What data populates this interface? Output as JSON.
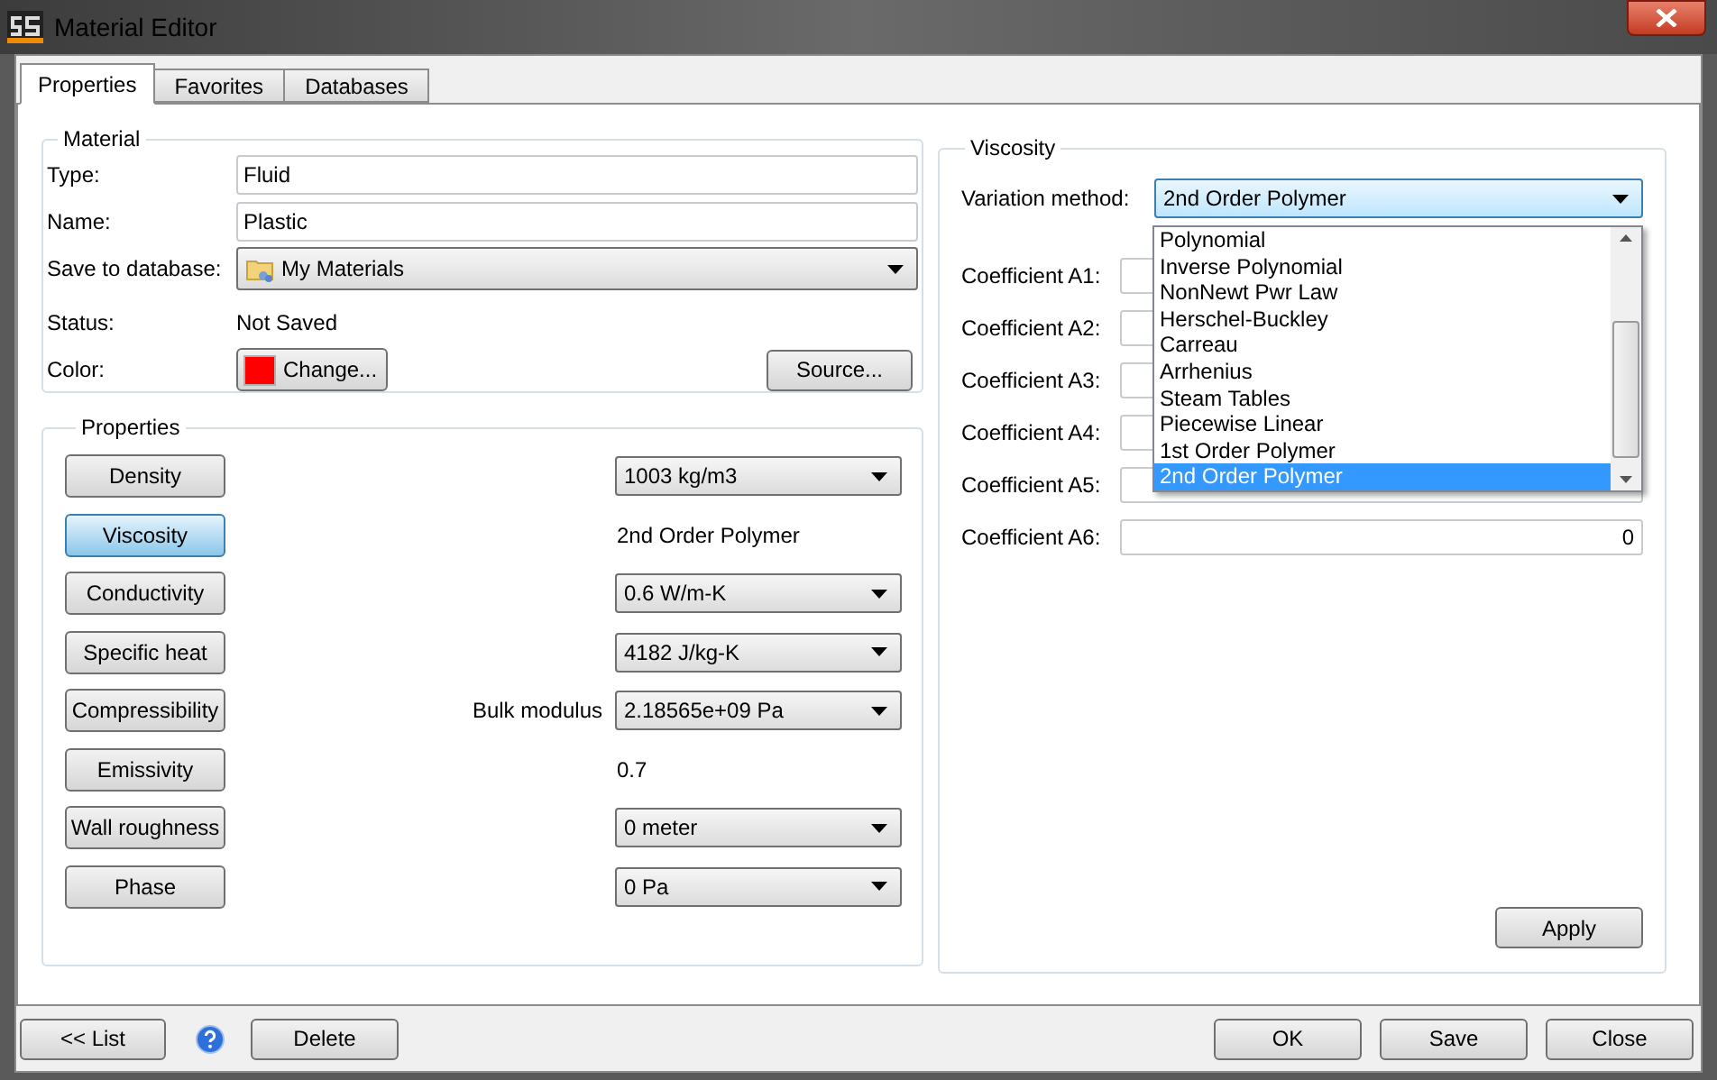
{
  "window": {
    "title": "Material Editor"
  },
  "tabs": [
    {
      "label": "Properties",
      "selected": true
    },
    {
      "label": "Favorites",
      "selected": false
    },
    {
      "label": "Databases",
      "selected": false
    }
  ],
  "material": {
    "title": "Material",
    "fields": [
      {
        "label": "Type:",
        "value": "Fluid",
        "kind": "input"
      },
      {
        "label": "Name:",
        "value": "Plastic",
        "kind": "input"
      },
      {
        "label": "Save to database:",
        "value": "My Materials",
        "kind": "dropdown"
      },
      {
        "label": "Status:",
        "value": "Not Saved",
        "kind": "text"
      }
    ],
    "color": {
      "label": "Color:",
      "color": "#ff0000",
      "button": "Change..."
    },
    "source_button": "Source..."
  },
  "properties": {
    "title": "Properties",
    "rows": [
      {
        "button": "Density",
        "selected": false,
        "kind": "dropdown",
        "value": "1003 kg/m3"
      },
      {
        "button": "Viscosity",
        "selected": true,
        "kind": "text",
        "value": "2nd Order Polymer"
      },
      {
        "button": "Conductivity",
        "selected": false,
        "kind": "dropdown",
        "value": "0.6 W/m-K"
      },
      {
        "button": "Specific heat",
        "selected": false,
        "kind": "dropdown",
        "value": "4182 J/kg-K"
      },
      {
        "button": "Compressibility",
        "selected": false,
        "kind": "dropdown",
        "label": "Bulk modulus",
        "value": "2.18565e+09 Pa"
      },
      {
        "button": "Emissivity",
        "selected": false,
        "kind": "text",
        "value": "0.7"
      },
      {
        "button": "Wall roughness",
        "selected": false,
        "kind": "dropdown",
        "value": "0 meter"
      },
      {
        "button": "Phase",
        "selected": false,
        "kind": "dropdown",
        "value": "0 Pa"
      }
    ]
  },
  "viscosity": {
    "title": "Viscosity",
    "method_label": "Variation method:",
    "method_value": "2nd Order Polymer",
    "options": [
      {
        "label": "Polynomial",
        "selected": false
      },
      {
        "label": "Inverse Polynomial",
        "selected": false
      },
      {
        "label": "NonNewt Pwr Law",
        "selected": false
      },
      {
        "label": "Herschel-Buckley",
        "selected": false
      },
      {
        "label": "Carreau",
        "selected": false
      },
      {
        "label": "Arrhenius",
        "selected": false
      },
      {
        "label": "Steam Tables",
        "selected": false
      },
      {
        "label": "Piecewise Linear",
        "selected": false
      },
      {
        "label": "1st Order Polymer",
        "selected": false
      },
      {
        "label": "2nd Order Polymer",
        "selected": true
      }
    ],
    "coefficients": [
      {
        "label": "Coefficient A1:"
      },
      {
        "label": "Coefficient A2:"
      },
      {
        "label": "Coefficient A3:"
      },
      {
        "label": "Coefficient A4:"
      },
      {
        "label": "Coefficient A5:"
      },
      {
        "label": "Coefficient A6:",
        "value": "0"
      }
    ],
    "apply_button": "Apply"
  },
  "footer": {
    "list_button": "<< List",
    "delete_button": "Delete",
    "buttons": [
      "OK",
      "Save",
      "Close"
    ]
  }
}
